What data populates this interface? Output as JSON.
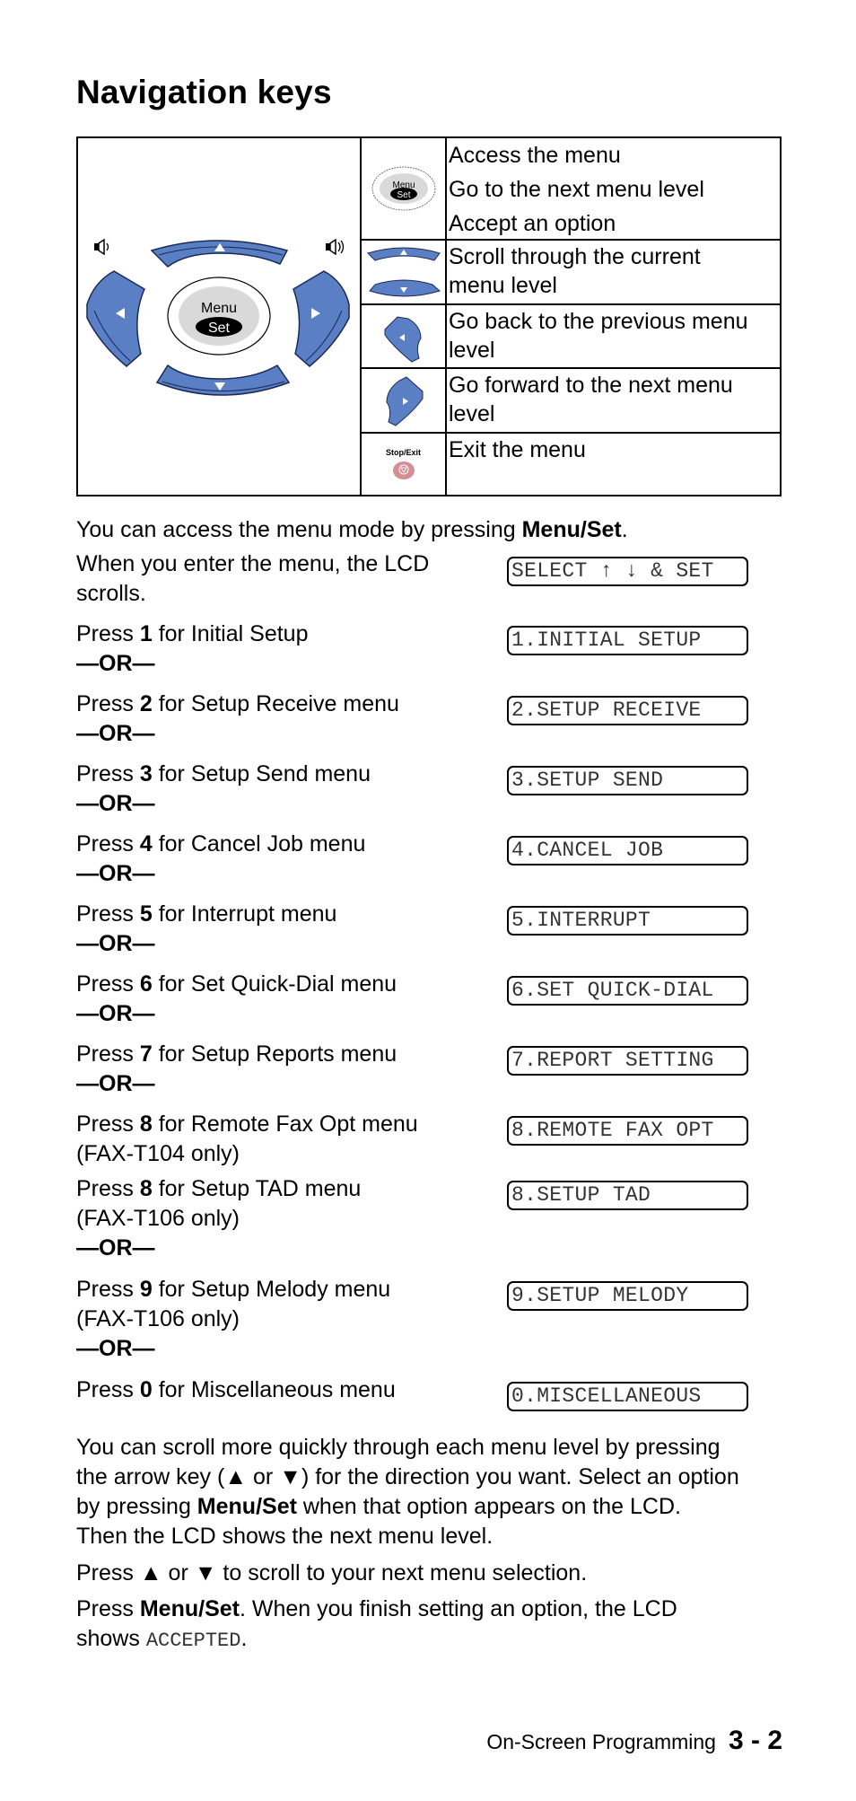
{
  "title": "Navigation keys",
  "key_table": {
    "diagram": {
      "volume_low_icon": "speaker-low",
      "volume_high_icon": "speaker-high",
      "center_key_line1": "Menu",
      "center_key_line2": "Set"
    },
    "rows": [
      {
        "icon": "menu-set-key",
        "icon_label_1": "Menu",
        "icon_label_2": "Set",
        "lines": [
          "Access the menu",
          "Go to the next menu level",
          "Accept an option"
        ]
      },
      {
        "icon": "up-down-keys",
        "lines": [
          "Scroll through the current",
          "menu level"
        ]
      },
      {
        "icon": "left-arrow-key",
        "lines": [
          "Go back to the previous menu",
          "level"
        ]
      },
      {
        "icon": "right-arrow-key",
        "lines": [
          "Go forward to the next menu",
          "level"
        ]
      },
      {
        "icon": "stop-exit-key",
        "icon_label_1": "Stop/Exit",
        "lines": [
          "Exit the menu"
        ]
      }
    ]
  },
  "intro": {
    "text": "You can access the menu mode by pressing ",
    "bold": "Menu/Set",
    "end": "."
  },
  "enter_menu": {
    "line1": "When you enter the menu, the LCD",
    "line2": "scrolls.",
    "lcd": "SELECT ↑ ↓ & SET"
  },
  "or_label": "—OR—",
  "steps": [
    {
      "pre": "Press ",
      "key": "1",
      "post": " for Initial Setup",
      "line2": "",
      "lcd": "1.INITIAL SETUP"
    },
    {
      "pre": "Press ",
      "key": "2",
      "post": " for Setup Receive menu",
      "line2": "",
      "lcd": "2.SETUP RECEIVE"
    },
    {
      "pre": "Press ",
      "key": "3",
      "post": " for Setup Send menu",
      "line2": "",
      "lcd": "3.SETUP SEND"
    },
    {
      "pre": "Press ",
      "key": "4",
      "post": " for Cancel Job menu",
      "line2": "",
      "lcd": "4.CANCEL JOB"
    },
    {
      "pre": "Press ",
      "key": "5",
      "post": " for Interrupt menu",
      "line2": "",
      "lcd": "5.INTERRUPT"
    },
    {
      "pre": "Press ",
      "key": "6",
      "post": " for Set Quick-Dial menu",
      "line2": "",
      "lcd": "6.SET QUICK-DIAL"
    },
    {
      "pre": "Press ",
      "key": "7",
      "post": " for Setup Reports menu",
      "line2": "",
      "lcd": "7.REPORT SETTING"
    },
    {
      "pre": "Press ",
      "key": "8",
      "post": " for Remote Fax Opt menu",
      "line2": "(FAX-T104 only)",
      "lcd": "8.REMOTE FAX OPT"
    },
    {
      "pre": "Press ",
      "key": "8",
      "post": " for Setup TAD menu",
      "line2": "(FAX-T106 only)",
      "lcd": "8.SETUP TAD"
    },
    {
      "pre": "Press ",
      "key": "9",
      "post": " for Setup Melody menu",
      "line2": "(FAX-T106 only)",
      "lcd": "9.SETUP MELODY"
    },
    {
      "pre": "Press ",
      "key": "0",
      "post": " for Miscellaneous menu",
      "line2": "",
      "lcd": "0.MISCELLANEOUS"
    }
  ],
  "scroll_para": {
    "l1": "You can scroll more quickly through each menu level by pressing",
    "l2": "the arrow key (▲ or ▼) for the direction you want. Select an option",
    "l3_pre": "by pressing ",
    "l3_bold": "Menu/Set",
    "l3_post": " when that option appears on the LCD.",
    "l4": "Then the LCD shows the next menu level."
  },
  "press_arrows": "Press ▲ or ▼ to scroll to your next menu selection.",
  "press_menuset": {
    "pre": "Press ",
    "bold": "Menu/Set",
    "post": ". When you finish setting an option, the LCD",
    "l2_pre": "shows ",
    "l2_mono": "ACCEPTED",
    "l2_post": "."
  },
  "footer": {
    "section": "On-Screen Programming",
    "page": "3 - 2"
  },
  "colors": {
    "key_blue": "#5a7fc4",
    "key_stroke": "#1a2a55",
    "menu_grey": "#d9d9d9",
    "stop_pink": "#d48e94"
  }
}
